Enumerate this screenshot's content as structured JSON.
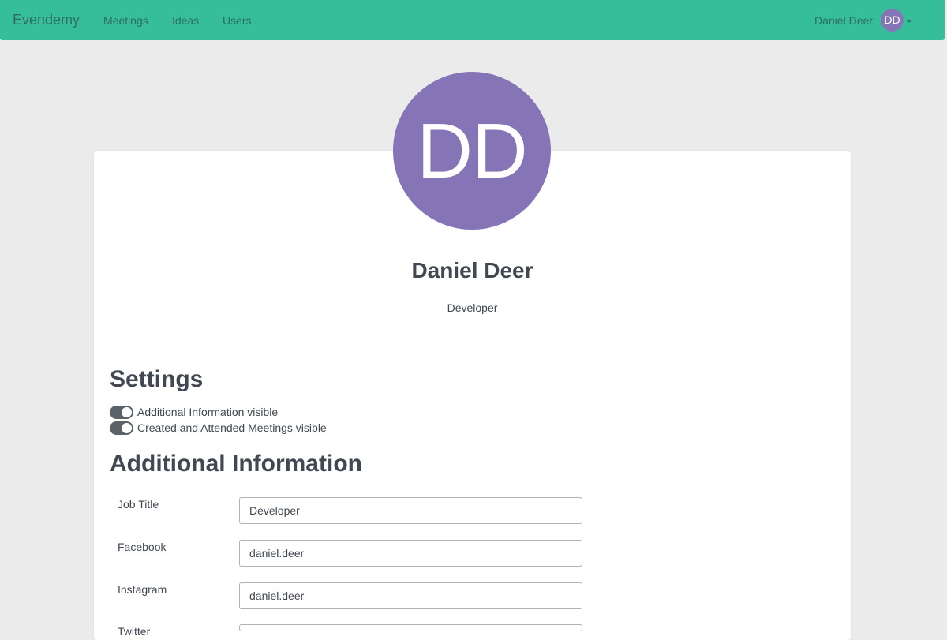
{
  "navbar": {
    "brand": "Evendemy",
    "links": [
      "Meetings",
      "Ideas",
      "Users"
    ],
    "user_name": "Daniel Deer",
    "user_initials": "DD"
  },
  "profile": {
    "initials": "DD",
    "name": "Daniel Deer",
    "role": "Developer"
  },
  "settings": {
    "title": "Settings",
    "toggles": [
      {
        "label": "Additional Information visible",
        "on": true
      },
      {
        "label": "Created and Attended Meetings visible",
        "on": true
      }
    ]
  },
  "additional_info": {
    "title": "Additional Information",
    "fields": [
      {
        "label": "Job Title",
        "value": "Developer"
      },
      {
        "label": "Facebook",
        "value": "daniel.deer"
      },
      {
        "label": "Instagram",
        "value": "daniel.deer"
      },
      {
        "label": "Twitter",
        "value": ""
      }
    ]
  },
  "colors": {
    "navbar": "#36be9a",
    "avatar": "#8574b6",
    "background": "#ebebeb",
    "switch_on": "#5b6268"
  }
}
